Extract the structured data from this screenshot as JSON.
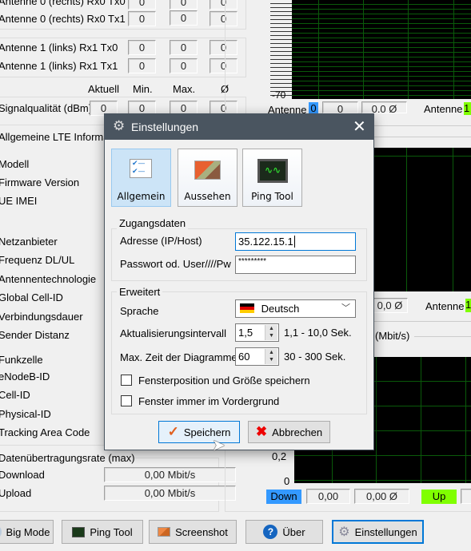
{
  "left": {
    "antenna_rows": [
      {
        "label": "Antenne 0 (rechts) Rx0 Tx0",
        "values": [
          "0",
          "0",
          "0"
        ]
      },
      {
        "label": "Antenne 0 (rechts) Rx0 Tx1",
        "values": [
          "0",
          "0",
          "0"
        ]
      },
      {
        "label": "Antenne 1 (links) Rx1 Tx0",
        "values": [
          "0",
          "0",
          "0"
        ]
      },
      {
        "label": "Antenne 1 (links) Rx1 Tx1",
        "values": [
          "0",
          "0",
          "0"
        ]
      }
    ],
    "headers": {
      "current": "Aktuell",
      "min": "Min.",
      "max": "Max.",
      "avg": "Ø"
    },
    "signal": {
      "label": "Signalqualität (dBm)",
      "values": [
        "0",
        "0",
        "0",
        "0"
      ]
    },
    "lte_info_title": "Allgemeine LTE Informati",
    "info_labels": [
      "Modell",
      "Firmware Version",
      "UE IMEI"
    ],
    "network_labels": [
      "Netzanbieter",
      "Frequenz DL/UL",
      "Antennentechnologie",
      "Global Cell-ID",
      "Verbindungsdauer",
      "Sender Distanz"
    ],
    "cell_title": "Funkzelle",
    "cell_labels": [
      "eNodeB-ID",
      "Cell-ID",
      "Physical-ID",
      "Tracking Area Code"
    ],
    "rate_title": "Datenübertragungsrate (max)",
    "download_label": "Download",
    "download_value": "0,00 Mbit/s",
    "upload_label": "Upload",
    "upload_value": "0,00 Mbit/s"
  },
  "right": {
    "chart1_bottom_tick": "-70",
    "antenna0": {
      "label": "Antenne",
      "index": "0",
      "value": "0",
      "avg": "0,0 Ø"
    },
    "antenna1": {
      "label": "Antenne",
      "index": "1"
    },
    "row2": {
      "avg": "0,0 Ø",
      "label": "Antenne",
      "index": "1"
    },
    "rate_unit": "(Mbit/s)",
    "ticks": [
      "0,2",
      "0"
    ],
    "down": {
      "label": "Down",
      "value": "0,00",
      "avg": "0,00 Ø"
    },
    "up": {
      "label": "Up"
    },
    "colors": {
      "blue": "#3399ff",
      "green": "#80ff00",
      "grid": "#0a5a0a"
    }
  },
  "toolbar": {
    "big_mode": "Big Mode",
    "ping_tool": "Ping Tool",
    "screenshot": "Screenshot",
    "about": "Über",
    "settings": "Einstellungen"
  },
  "dialog": {
    "title": "Einstellungen",
    "tabs": [
      "Allgemein",
      "Aussehen",
      "Ping Tool"
    ],
    "access_group": "Zugangsdaten",
    "address_label": "Adresse (IP/Host)",
    "address_value": "35.122.15.1",
    "password_label": "Passwort od. User////Pw",
    "password_value": "*********",
    "extended_group": "Erweitert",
    "language_label": "Sprache",
    "language_value": "Deutsch",
    "interval_label": "Aktualisierungsintervall",
    "interval_value": "1,5",
    "interval_range": "1,1 - 10,0 Sek.",
    "chart_time_label": "Max. Zeit der Diagramme",
    "chart_time_value": "60",
    "chart_time_range": "30 - 300 Sek.",
    "checkbox_position": {
      "label": "Fensterposition und Größe speichern",
      "checked": false
    },
    "checkbox_foreground": {
      "label": "Fenster immer im Vordergrund",
      "checked": false
    },
    "save": "Speichern",
    "cancel": "Abbrechen"
  }
}
